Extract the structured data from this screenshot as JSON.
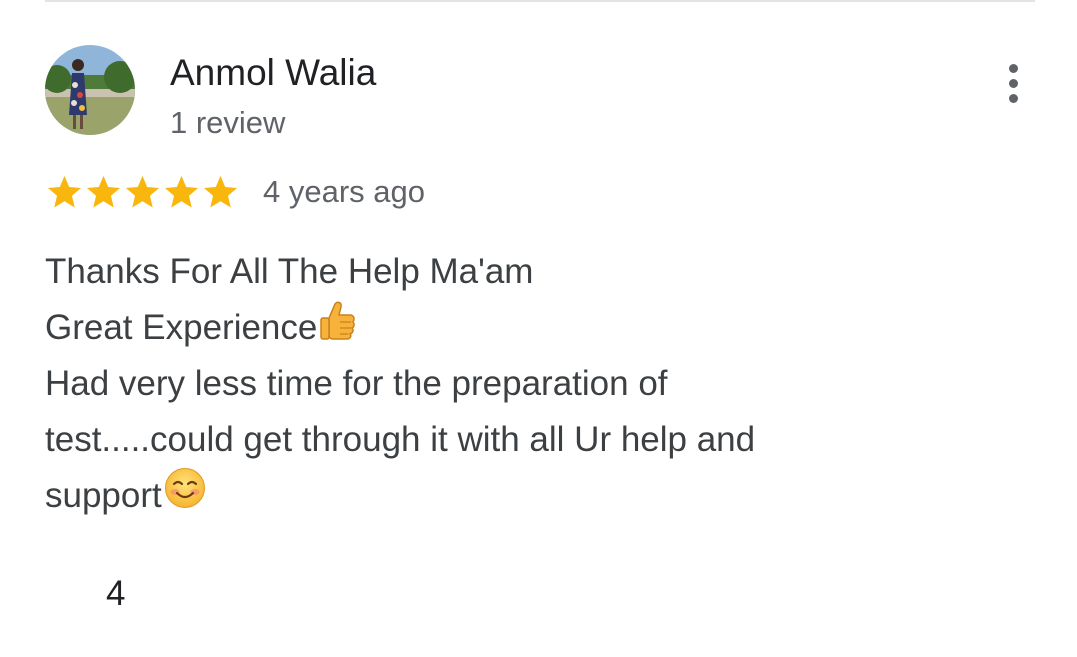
{
  "review": {
    "author": {
      "name": "Anmol Walia",
      "review_count": "1 review",
      "avatar_icon": "user-avatar-photo"
    },
    "rating": {
      "stars": 5,
      "max_stars": 5,
      "star_color": "#f9b70e",
      "star_icon": "star-icon"
    },
    "time": "4 years ago",
    "text_lines": [
      "Thanks For All The Help Ma'am",
      "Great Experience",
      "Had very less time for the preparation of",
      "test.....could get through it with all Ur help and",
      "support"
    ],
    "emojis": {
      "line2": "thumbs-up-icon",
      "line5": "smiling-face-icon"
    },
    "like_count": "4",
    "more_icon": "more-vertical-icon"
  },
  "colors": {
    "primary_text": "#202124",
    "secondary_text": "#5f6368",
    "body_text": "#3c4043",
    "divider": "#e3e3e3"
  }
}
